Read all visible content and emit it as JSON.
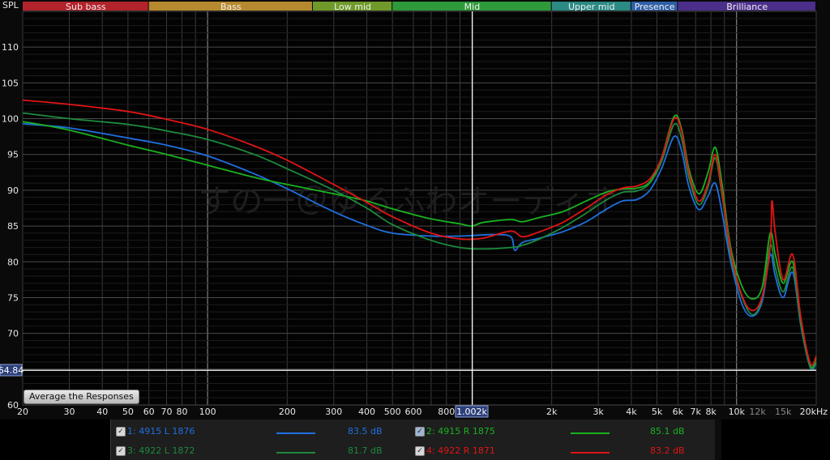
{
  "bands": [
    {
      "label": "Sub bass",
      "from": 20,
      "to": 60,
      "color": "#b3232c"
    },
    {
      "label": "Bass",
      "from": 60,
      "to": 250,
      "color": "#b7892e"
    },
    {
      "label": "Low mid",
      "from": 250,
      "to": 500,
      "color": "#6f9a2a"
    },
    {
      "label": "Mid",
      "from": 500,
      "to": 2000,
      "color": "#2f9a3a"
    },
    {
      "label": "Upper mid",
      "from": 2000,
      "to": 4000,
      "color": "#2b8a84"
    },
    {
      "label": "Presence",
      "from": 4000,
      "to": 6000,
      "color": "#2f5fa8"
    },
    {
      "label": "Brilliance",
      "from": 6000,
      "to": 20000,
      "color": "#4b2f8a"
    }
  ],
  "axis": {
    "y_label": "SPL",
    "x_unit_label": "20kHz",
    "cursor_x_label": "1.002k",
    "cursor_y_label": "64.84",
    "x_tick_labels": [
      "20",
      "30",
      "40",
      "50",
      "60",
      "70",
      "80",
      "100",
      "200",
      "300",
      "400",
      "500",
      "600",
      "800",
      "2k",
      "3k",
      "4k",
      "5k",
      "6k",
      "7k",
      "8k",
      "10k",
      "12k",
      "15k"
    ],
    "y_tick_labels": [
      "60",
      "65",
      "70",
      "75",
      "80",
      "85",
      "90",
      "95",
      "100",
      "105",
      "110"
    ],
    "watermark": "すの一＠ゆるふわオーディオ"
  },
  "average_button": "Average the Responses",
  "legend": [
    {
      "check": "✓",
      "name": "1: 4915 L 1876",
      "value": "83.5 dB",
      "color": "#1f6fe0"
    },
    {
      "check": "✓",
      "name": "2: 4915 R 1875",
      "value": "85.1 dB",
      "color": "#19b21f"
    },
    {
      "check": "✓",
      "name": "3: 4922 L 1872",
      "value": "81.7 dB",
      "color": "#1d8a3c"
    },
    {
      "check": "✓",
      "name": "4: 4922 R 1871",
      "value": "83.2 dB",
      "color": "#e21414"
    }
  ],
  "chart_data": {
    "type": "line",
    "title": "",
    "xlabel": "",
    "ylabel": "SPL",
    "x_scale": "log",
    "xlim": [
      20,
      20000
    ],
    "ylim": [
      60,
      115
    ],
    "grid": true,
    "cursor": {
      "x": 1002,
      "y": 64.84
    },
    "series": [
      {
        "name": "1: 4915 L 1876",
        "color": "#1f6fe0",
        "points": [
          [
            20,
            99.3
          ],
          [
            30,
            98.7
          ],
          [
            50,
            97.3
          ],
          [
            70,
            96.3
          ],
          [
            100,
            94.8
          ],
          [
            150,
            92.3
          ],
          [
            200,
            90.2
          ],
          [
            300,
            87.0
          ],
          [
            400,
            85.1
          ],
          [
            500,
            84.0
          ],
          [
            700,
            83.6
          ],
          [
            900,
            83.6
          ],
          [
            1200,
            83.8
          ],
          [
            1400,
            83.5
          ],
          [
            1450,
            81.6
          ],
          [
            1550,
            82.7
          ],
          [
            1800,
            83.3
          ],
          [
            2200,
            84.2
          ],
          [
            2700,
            85.6
          ],
          [
            3200,
            87.3
          ],
          [
            3700,
            88.5
          ],
          [
            4200,
            88.7
          ],
          [
            4700,
            90.0
          ],
          [
            5200,
            93.0
          ],
          [
            5800,
            97.5
          ],
          [
            6200,
            95.5
          ],
          [
            6600,
            90.5
          ],
          [
            7200,
            87.3
          ],
          [
            7800,
            89.2
          ],
          [
            8300,
            91.0
          ],
          [
            8800,
            87.0
          ],
          [
            9500,
            80.0
          ],
          [
            10500,
            74.0
          ],
          [
            11500,
            72.4
          ],
          [
            12500,
            74.5
          ],
          [
            13400,
            81.0
          ],
          [
            14000,
            78.0
          ],
          [
            15000,
            75.0
          ],
          [
            16300,
            78.5
          ],
          [
            17500,
            71.0
          ],
          [
            19000,
            65.2
          ],
          [
            20000,
            65.8
          ]
        ]
      },
      {
        "name": "2: 4915 R 1875",
        "color": "#19b21f",
        "points": [
          [
            20,
            99.6
          ],
          [
            30,
            98.4
          ],
          [
            50,
            96.3
          ],
          [
            70,
            95.0
          ],
          [
            100,
            93.5
          ],
          [
            150,
            91.8
          ],
          [
            200,
            90.8
          ],
          [
            300,
            89.5
          ],
          [
            400,
            88.5
          ],
          [
            500,
            87.4
          ],
          [
            700,
            86.0
          ],
          [
            900,
            85.3
          ],
          [
            1000,
            85.0
          ],
          [
            1100,
            85.5
          ],
          [
            1400,
            85.9
          ],
          [
            1550,
            85.6
          ],
          [
            1800,
            86.2
          ],
          [
            2200,
            87.0
          ],
          [
            2700,
            88.5
          ],
          [
            3200,
            89.7
          ],
          [
            3700,
            90.2
          ],
          [
            4200,
            90.3
          ],
          [
            4700,
            91.2
          ],
          [
            5200,
            94.5
          ],
          [
            5800,
            100.3
          ],
          [
            6200,
            98.5
          ],
          [
            6600,
            93.0
          ],
          [
            7200,
            89.5
          ],
          [
            7800,
            92.5
          ],
          [
            8300,
            96.0
          ],
          [
            8800,
            91.0
          ],
          [
            9500,
            82.0
          ],
          [
            10500,
            76.5
          ],
          [
            11500,
            74.8
          ],
          [
            12500,
            76.5
          ],
          [
            13400,
            84.0
          ],
          [
            14000,
            81.0
          ],
          [
            15000,
            77.0
          ],
          [
            16300,
            80.0
          ],
          [
            17500,
            72.0
          ],
          [
            19000,
            65.5
          ],
          [
            20000,
            66.5
          ]
        ]
      },
      {
        "name": "3: 4922 L 1872",
        "color": "#1d8a3c",
        "points": [
          [
            20,
            100.8
          ],
          [
            30,
            100.0
          ],
          [
            50,
            99.2
          ],
          [
            70,
            98.3
          ],
          [
            100,
            97.1
          ],
          [
            150,
            95.0
          ],
          [
            200,
            93.0
          ],
          [
            300,
            90.0
          ],
          [
            400,
            87.5
          ],
          [
            500,
            85.2
          ],
          [
            700,
            83.0
          ],
          [
            900,
            82.0
          ],
          [
            1100,
            81.8
          ],
          [
            1400,
            82.0
          ],
          [
            1550,
            82.3
          ],
          [
            1800,
            83.2
          ],
          [
            2200,
            84.8
          ],
          [
            2700,
            86.8
          ],
          [
            3200,
            88.6
          ],
          [
            3700,
            89.7
          ],
          [
            4200,
            89.9
          ],
          [
            4700,
            91.0
          ],
          [
            5200,
            94.0
          ],
          [
            5800,
            99.2
          ],
          [
            6200,
            97.2
          ],
          [
            6600,
            91.8
          ],
          [
            7200,
            88.0
          ],
          [
            7800,
            90.5
          ],
          [
            8300,
            94.5
          ],
          [
            8800,
            89.5
          ],
          [
            9500,
            80.8
          ],
          [
            10500,
            75.0
          ],
          [
            11500,
            72.6
          ],
          [
            12500,
            75.0
          ],
          [
            13400,
            82.3
          ],
          [
            14000,
            79.2
          ],
          [
            15000,
            75.8
          ],
          [
            16300,
            79.2
          ],
          [
            17500,
            71.2
          ],
          [
            19000,
            65.3
          ],
          [
            20000,
            66.0
          ]
        ]
      },
      {
        "name": "4: 4922 R 1871",
        "color": "#e21414",
        "points": [
          [
            20,
            102.6
          ],
          [
            30,
            102.0
          ],
          [
            50,
            101.0
          ],
          [
            70,
            99.9
          ],
          [
            100,
            98.5
          ],
          [
            150,
            96.2
          ],
          [
            200,
            94.2
          ],
          [
            300,
            90.8
          ],
          [
            400,
            88.3
          ],
          [
            500,
            86.3
          ],
          [
            700,
            84.0
          ],
          [
            900,
            83.2
          ],
          [
            1100,
            83.3
          ],
          [
            1400,
            84.3
          ],
          [
            1550,
            83.5
          ],
          [
            1800,
            84.2
          ],
          [
            2200,
            85.5
          ],
          [
            2700,
            87.5
          ],
          [
            3200,
            89.3
          ],
          [
            3700,
            90.3
          ],
          [
            4200,
            90.6
          ],
          [
            4700,
            91.6
          ],
          [
            5200,
            94.5
          ],
          [
            5800,
            100.0
          ],
          [
            6200,
            98.2
          ],
          [
            6600,
            92.5
          ],
          [
            7200,
            88.5
          ],
          [
            7800,
            91.0
          ],
          [
            8300,
            95.0
          ],
          [
            8800,
            90.0
          ],
          [
            9500,
            81.5
          ],
          [
            10500,
            75.2
          ],
          [
            11500,
            73.2
          ],
          [
            12500,
            75.2
          ],
          [
            13400,
            82.0
          ],
          [
            13600,
            88.5
          ],
          [
            14000,
            84.0
          ],
          [
            15000,
            77.5
          ],
          [
            16300,
            81.0
          ],
          [
            17500,
            72.2
          ],
          [
            19000,
            65.8
          ],
          [
            20000,
            66.8
          ]
        ]
      }
    ]
  }
}
